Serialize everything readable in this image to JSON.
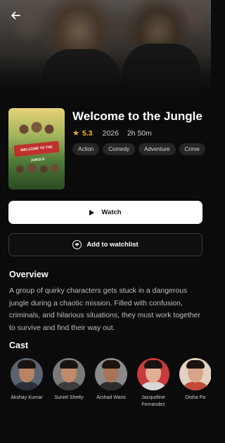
{
  "movie": {
    "title": "Welcome to the Jungle",
    "rating": "5.3",
    "year": "2026",
    "runtime": "2h 50m",
    "genres": [
      "Action",
      "Comedy",
      "Adventure",
      "Crime"
    ],
    "poster_text": "WELCOME TO THE JUNGLE"
  },
  "actions": {
    "trailer_label": "Watch",
    "watchlist_label": "Add to watchlist"
  },
  "overview": {
    "heading": "Overview",
    "text": "A group of quirky characters gets stuck in a dangerous jungle during a chaotic mission. Filled with confusion, criminals, and hilarious situations, they must work together to survive and find their way out."
  },
  "cast": {
    "heading": "Cast",
    "members": [
      {
        "name": "Akshay Kumar",
        "skin": "#b88465",
        "shirt": "#2a2f3a",
        "bg": "#5a6470"
      },
      {
        "name": "Suniel Shetty",
        "skin": "#c08c6a",
        "shirt": "#3b3b3b",
        "bg": "#7a7a7a"
      },
      {
        "name": "Arshad Warsi",
        "skin": "#a87458",
        "shirt": "#2e2e2e",
        "bg": "#8a8a8a"
      },
      {
        "name": "Jacqueline Fernandez",
        "skin": "#e0b094",
        "shirt": "#d7d7d7",
        "bg": "#c93a3a"
      },
      {
        "name": "Disha Pa",
        "skin": "#d6a488",
        "shirt": "#c24a3a",
        "bg": "#e3d2c2"
      }
    ]
  },
  "colors": {
    "background": "#0b0b0b",
    "accent_star": "#f2b928",
    "chip_bg": "#262626"
  },
  "icons": {
    "back": "arrow-left-icon",
    "star": "star-icon",
    "play": "play-icon",
    "add": "plus-circle-icon"
  }
}
